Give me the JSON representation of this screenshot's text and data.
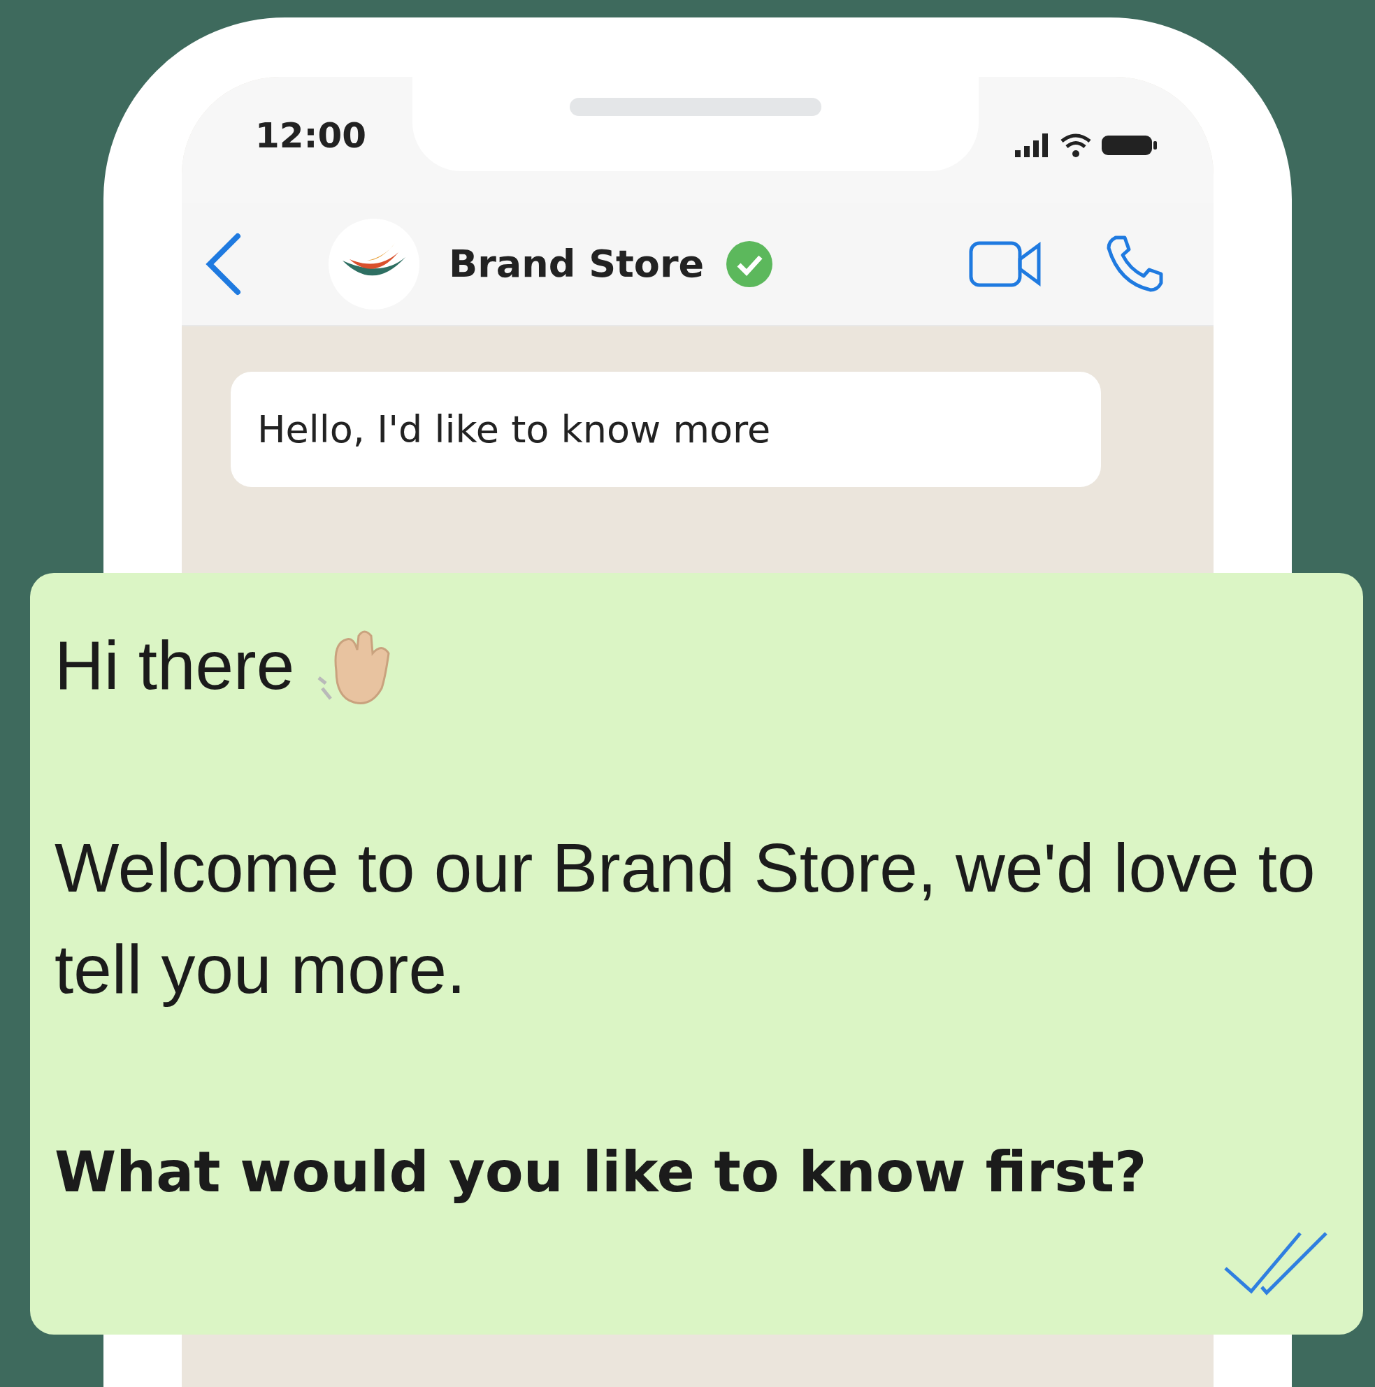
{
  "status_bar": {
    "time": "12:00"
  },
  "chat_header": {
    "title": "Brand Store",
    "verified": true
  },
  "messages": [
    {
      "kind": "incoming",
      "text": "Hello, I'd like to know more"
    },
    {
      "kind": "outgoing",
      "read": true,
      "paragraphs": [
        {
          "kind": "greeting",
          "text": "Hi there"
        },
        {
          "kind": "body",
          "text": "Welcome to our Brand Store, we'd love to tell you more."
        },
        {
          "kind": "question",
          "text": "What would you like to know first?"
        }
      ]
    }
  ]
}
